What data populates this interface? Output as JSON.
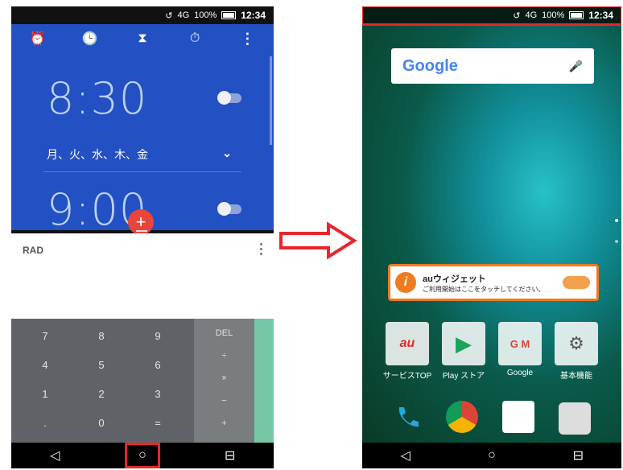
{
  "left_phone": {
    "status": {
      "signal": "4G",
      "battery": "100%",
      "time": "12:34"
    },
    "clock": {
      "tabs": [
        {
          "icon": "alarm-clock-icon",
          "glyph": "⏰"
        },
        {
          "icon": "clock-icon",
          "glyph": "🕒"
        },
        {
          "icon": "hourglass-icon",
          "glyph": "⧗"
        },
        {
          "icon": "stopwatch-icon",
          "glyph": "⏱"
        }
      ],
      "menu_glyph": "⋮",
      "alarms": [
        {
          "time": "8:30"
        },
        {
          "time": "9:00"
        }
      ],
      "days": [
        "月、",
        "火、",
        "水、",
        "木、",
        "金"
      ],
      "expand_glyph": "⌄",
      "fab_glyph": "+"
    },
    "calculator": {
      "mode": "RAD",
      "keys": [
        "7",
        "8",
        "9",
        "4",
        "5",
        "6",
        "1",
        "2",
        "3",
        ".",
        "0",
        "="
      ],
      "ops": [
        "DEL",
        "÷",
        "×",
        "−",
        "+"
      ]
    },
    "nav": {
      "back": "◁",
      "home": "○",
      "recents": "⊟"
    }
  },
  "right_phone": {
    "status": {
      "signal": "4G",
      "battery": "100%",
      "time": "12:34"
    },
    "google": {
      "logo": "Google",
      "mic_glyph": "🎤"
    },
    "au_widget": {
      "title": "auウィジェット",
      "subtitle": "ご利用開始はここをタッチしてください。",
      "icon_text": "i"
    },
    "apps": [
      {
        "label": "サービスTOP",
        "icon_text": "au"
      },
      {
        "label": "Play ストア",
        "icon_text": "▶"
      },
      {
        "label": "Google",
        "icon_text": "G M"
      },
      {
        "label": "基本機能",
        "icon_text": "⚙"
      }
    ],
    "nav": {
      "back": "◁",
      "home": "○",
      "recents": "⊟"
    }
  },
  "colors": {
    "highlight": "#e8252d",
    "clock_bg": "#2350c2",
    "fab": "#e9453b"
  }
}
